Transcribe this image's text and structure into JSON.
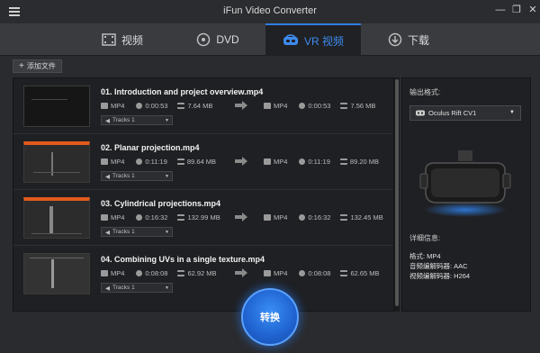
{
  "app": {
    "title": "iFun Video Converter"
  },
  "window_controls": {
    "minimize": "—",
    "maximize": "❐",
    "close": "✕"
  },
  "tabs": [
    {
      "label": "视频",
      "icon": "film-icon",
      "active": false
    },
    {
      "label": "DVD",
      "icon": "disc-icon",
      "active": false
    },
    {
      "label": "VR 视频",
      "icon": "vr-headset-icon",
      "active": true
    },
    {
      "label": "下载",
      "icon": "download-icon",
      "active": false
    }
  ],
  "toolbar": {
    "add_file_label": "添加文件"
  },
  "files": [
    {
      "name": "01. Introduction and project overview.mp4",
      "src_format": "MP4",
      "src_duration": "0:00:53",
      "src_size": "7.64 MB",
      "out_format": "MP4",
      "out_duration": "0:00:53",
      "out_size": "7.56 MB",
      "track": "Tracks 1"
    },
    {
      "name": "02. Planar projection.mp4",
      "src_format": "MP4",
      "src_duration": "0:11:19",
      "src_size": "89.64 MB",
      "out_format": "MP4",
      "out_duration": "0:11:19",
      "out_size": "89.20 MB",
      "track": "Tracks 1"
    },
    {
      "name": "03. Cylindrical projections.mp4",
      "src_format": "MP4",
      "src_duration": "0:16:32",
      "src_size": "132.99 MB",
      "out_format": "MP4",
      "out_duration": "0:16:32",
      "out_size": "132.45 MB",
      "track": "Tracks 1"
    },
    {
      "name": "04. Combining UVs in a single texture.mp4",
      "src_format": "MP4",
      "src_duration": "0:08:08",
      "src_size": "62.92 MB",
      "out_format": "MP4",
      "out_duration": "0:08:08",
      "out_size": "62.65 MB",
      "track": "Tracks 1"
    }
  ],
  "output": {
    "label": "输出格式:",
    "selected": "Oculus Rift CV1",
    "details_label": "详细信息:",
    "format_line": "格式: MP4",
    "audio_line": "音频编解码器: AAC",
    "video_line": "视频编解码器: H264"
  },
  "convert_label": "转换",
  "colors": {
    "accent": "#2f7de1",
    "background": "#2a2b2e",
    "panel": "#1f2023"
  }
}
